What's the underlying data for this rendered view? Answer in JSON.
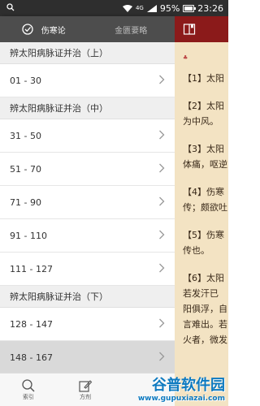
{
  "status": {
    "battery": "95%",
    "time": "23:26",
    "network": "4G",
    "battery_level": 0.95
  },
  "tabs": [
    {
      "label": "伤寒论"
    },
    {
      "label": "金匮要略"
    }
  ],
  "sections": [
    {
      "header": "辨太阳病脉证并治（上）",
      "rows": [
        "01 - 30"
      ]
    },
    {
      "header": "辨太阳病脉证并治（中）",
      "rows": [
        "31 - 50",
        "51 - 70",
        "71 - 90",
        "91 - 110",
        "111 - 127"
      ]
    },
    {
      "header": "辨太阳病脉证并治（下）",
      "rows": [
        "128 - 147",
        "148 - 167"
      ]
    }
  ],
  "bottom_nav": [
    {
      "label": "索引",
      "icon": "search-icon"
    },
    {
      "label": "方剂",
      "icon": "edit-icon"
    }
  ],
  "reader": {
    "mark": "♣",
    "lines": [
      [
        "【1】太阳"
      ],
      [
        "【2】太阳",
        "为中风。"
      ],
      [
        "【3】太阳",
        "体痛，呕逆"
      ],
      [
        "【4】伤寒",
        "传；颇欲吐"
      ],
      [
        "【5】伤寒",
        "传也。"
      ],
      [
        "【6】太阳",
        "若发汗已",
        "阳俱浮，自",
        "言难出。若",
        "火者，微发"
      ]
    ]
  },
  "watermark": {
    "title": "谷普软件园",
    "url": "www.gupuxiazai.com"
  },
  "colors": {
    "tab_bar": "#4d4d4d",
    "reader_bar": "#8b1a1a",
    "reader_bg": "#f3e3c3",
    "section_bg": "#efefef",
    "selected_row": "#d9d9d9"
  }
}
